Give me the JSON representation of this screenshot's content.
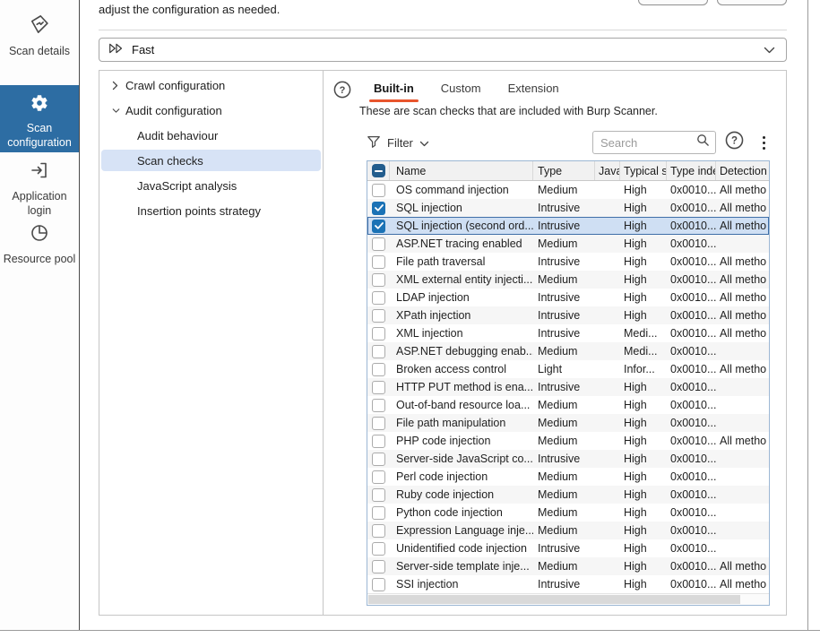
{
  "colors": {
    "sidebar_selected_bg": "#2d6da3",
    "tab_accent": "#e8552d",
    "row_selected_bg": "#cfdff3",
    "row_selected_border": "#3f6fa8",
    "checkbox_checked": "#1b72b5",
    "checkbox_indeterminate": "#235d8d",
    "tree_selected_bg": "#d7e3f6",
    "table_border": "#9cb7d4"
  },
  "top": {
    "intro_text": "adjust the configuration as needed.",
    "profile_selector": {
      "value": "Fast"
    }
  },
  "sidebar": {
    "items": [
      {
        "label": "Scan details",
        "selected": false
      },
      {
        "label": "Scan configuration",
        "selected": true
      },
      {
        "label": "Application login",
        "selected": false
      },
      {
        "label": "Resource pool",
        "selected": false
      }
    ]
  },
  "tree": {
    "items": [
      {
        "label": "Crawl configuration",
        "state": "collapsed",
        "level": 0
      },
      {
        "label": "Audit configuration",
        "state": "expanded",
        "level": 0
      },
      {
        "label": "Audit behaviour",
        "level": 1,
        "selected": false
      },
      {
        "label": "Scan checks",
        "level": 1,
        "selected": true
      },
      {
        "label": "JavaScript analysis",
        "level": 1,
        "selected": false
      },
      {
        "label": "Insertion points strategy",
        "level": 1,
        "selected": false
      }
    ]
  },
  "panel": {
    "tabs": [
      {
        "label": "Built-in",
        "active": true
      },
      {
        "label": "Custom",
        "active": false
      },
      {
        "label": "Extension",
        "active": false
      }
    ],
    "description": "These are scan checks that are included with Burp Scanner.",
    "filter_label": "Filter",
    "search_placeholder": "Search"
  },
  "table": {
    "header_checkbox_state": "indeterminate",
    "columns": {
      "name": "Name",
      "type": "Type",
      "java": "Java",
      "severity": "Typical s",
      "type_index": "Type inde",
      "detection": "Detection"
    },
    "rows": [
      {
        "checked": false,
        "selected": false,
        "name": "OS command injection",
        "type": "Medium",
        "severity": "High",
        "type_index": "0x0010...",
        "detection": "All metho"
      },
      {
        "checked": true,
        "selected": false,
        "name": "SQL injection",
        "type": "Intrusive",
        "severity": "High",
        "type_index": "0x0010...",
        "detection": "All metho"
      },
      {
        "checked": true,
        "selected": true,
        "name": "SQL injection (second ord...",
        "type": "Intrusive",
        "severity": "High",
        "type_index": "0x0010...",
        "detection": "All metho"
      },
      {
        "checked": false,
        "selected": false,
        "name": "ASP.NET tracing enabled",
        "type": "Medium",
        "severity": "High",
        "type_index": "0x0010...",
        "detection": ""
      },
      {
        "checked": false,
        "selected": false,
        "name": "File path traversal",
        "type": "Intrusive",
        "severity": "High",
        "type_index": "0x0010...",
        "detection": "All metho"
      },
      {
        "checked": false,
        "selected": false,
        "name": "XML external entity injecti...",
        "type": "Medium",
        "severity": "High",
        "type_index": "0x0010...",
        "detection": "All metho"
      },
      {
        "checked": false,
        "selected": false,
        "name": "LDAP injection",
        "type": "Intrusive",
        "severity": "High",
        "type_index": "0x0010...",
        "detection": "All metho"
      },
      {
        "checked": false,
        "selected": false,
        "name": "XPath injection",
        "type": "Intrusive",
        "severity": "High",
        "type_index": "0x0010...",
        "detection": "All metho"
      },
      {
        "checked": false,
        "selected": false,
        "name": "XML injection",
        "type": "Intrusive",
        "severity": "Medi...",
        "type_index": "0x0010...",
        "detection": "All metho"
      },
      {
        "checked": false,
        "selected": false,
        "name": "ASP.NET debugging enab...",
        "type": "Medium",
        "severity": "Medi...",
        "type_index": "0x0010...",
        "detection": ""
      },
      {
        "checked": false,
        "selected": false,
        "name": "Broken access control",
        "type": "Light",
        "severity": "Infor...",
        "type_index": "0x0010...",
        "detection": "All metho"
      },
      {
        "checked": false,
        "selected": false,
        "name": "HTTP PUT method is ena...",
        "type": "Intrusive",
        "severity": "High",
        "type_index": "0x0010...",
        "detection": ""
      },
      {
        "checked": false,
        "selected": false,
        "name": "Out-of-band resource loa...",
        "type": "Medium",
        "severity": "High",
        "type_index": "0x0010...",
        "detection": ""
      },
      {
        "checked": false,
        "selected": false,
        "name": "File path manipulation",
        "type": "Medium",
        "severity": "High",
        "type_index": "0x0010...",
        "detection": ""
      },
      {
        "checked": false,
        "selected": false,
        "name": "PHP code injection",
        "type": "Medium",
        "severity": "High",
        "type_index": "0x0010...",
        "detection": "All metho"
      },
      {
        "checked": false,
        "selected": false,
        "name": "Server-side JavaScript co...",
        "type": "Intrusive",
        "severity": "High",
        "type_index": "0x0010...",
        "detection": ""
      },
      {
        "checked": false,
        "selected": false,
        "name": "Perl code injection",
        "type": "Medium",
        "severity": "High",
        "type_index": "0x0010...",
        "detection": ""
      },
      {
        "checked": false,
        "selected": false,
        "name": "Ruby code injection",
        "type": "Medium",
        "severity": "High",
        "type_index": "0x0010...",
        "detection": ""
      },
      {
        "checked": false,
        "selected": false,
        "name": "Python code injection",
        "type": "Medium",
        "severity": "High",
        "type_index": "0x0010...",
        "detection": ""
      },
      {
        "checked": false,
        "selected": false,
        "name": "Expression Language inje...",
        "type": "Medium",
        "severity": "High",
        "type_index": "0x0010...",
        "detection": ""
      },
      {
        "checked": false,
        "selected": false,
        "name": "Unidentified code injection",
        "type": "Intrusive",
        "severity": "High",
        "type_index": "0x0010...",
        "detection": ""
      },
      {
        "checked": false,
        "selected": false,
        "name": "Server-side template inje...",
        "type": "Medium",
        "severity": "High",
        "type_index": "0x0010...",
        "detection": "All metho"
      },
      {
        "checked": false,
        "selected": false,
        "name": "SSI injection",
        "type": "Intrusive",
        "severity": "High",
        "type_index": "0x0010...",
        "detection": "All metho"
      }
    ]
  }
}
